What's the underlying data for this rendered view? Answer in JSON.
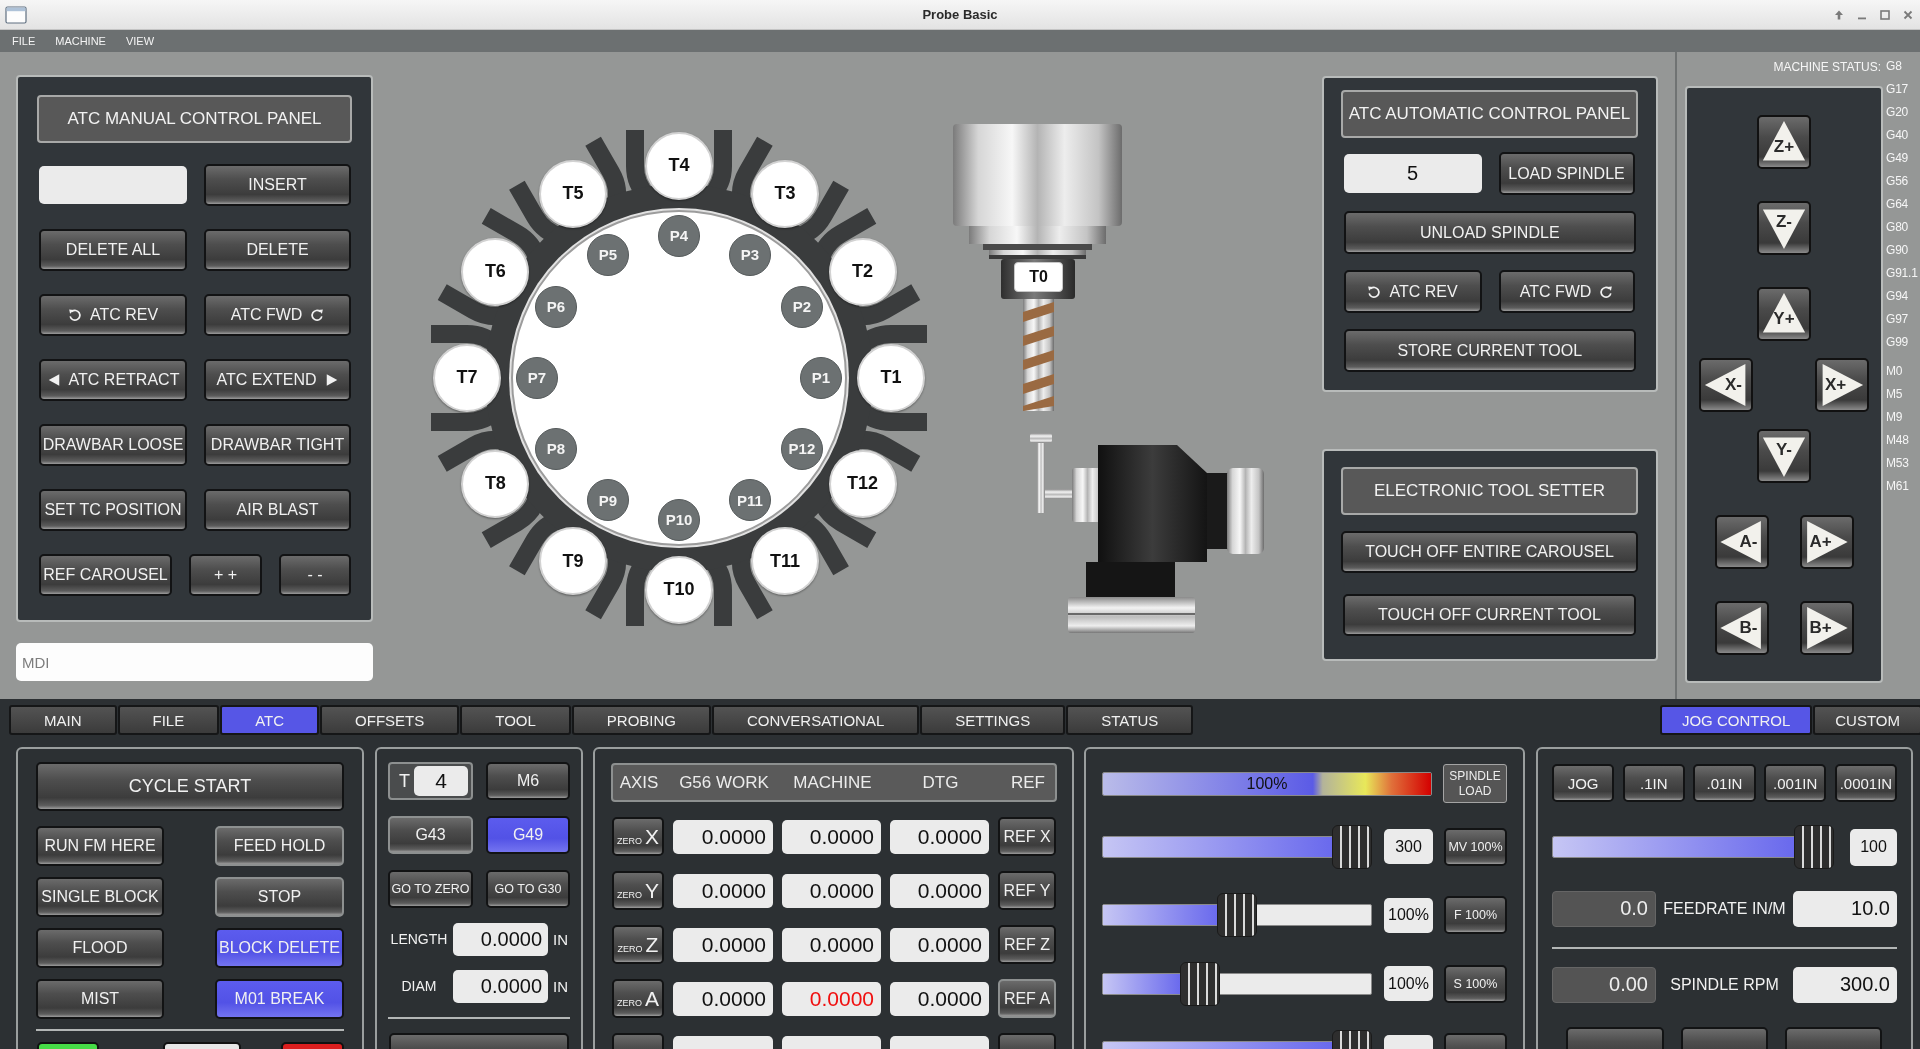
{
  "window": {
    "title": "Probe Basic"
  },
  "menu": [
    {
      "label": "FILE"
    },
    {
      "label": "MACHINE"
    },
    {
      "label": "VIEW"
    }
  ],
  "atc_manual": {
    "title": "ATC MANUAL CONTROL PANEL",
    "insert": "INSERT",
    "rows": [
      [
        {
          "label": "DELETE ALL",
          "kind": "push"
        },
        {
          "label": "DELETE",
          "kind": "push"
        }
      ],
      [
        {
          "label": "ATC REV",
          "kind": "rev"
        },
        {
          "label": "ATC FWD",
          "kind": "fwd"
        }
      ],
      [
        {
          "label": "ATC RETRACT",
          "kind": "retract"
        },
        {
          "label": "ATC EXTEND",
          "kind": "extend"
        }
      ],
      [
        {
          "label": "DRAWBAR LOOSE",
          "kind": "push"
        },
        {
          "label": "DRAWBAR TIGHT",
          "kind": "push"
        }
      ],
      [
        {
          "label": "SET TC POSITION",
          "kind": "push"
        },
        {
          "label": "AIR BLAST",
          "kind": "push"
        }
      ]
    ],
    "bottom_row": [
      {
        "label": "REF CAROUSEL"
      },
      {
        "label": "+ +"
      },
      {
        "label": "- -"
      }
    ]
  },
  "mdi": {
    "placeholder": "MDI"
  },
  "carousel": {
    "tools": [
      "T1",
      "T2",
      "T3",
      "T4",
      "T5",
      "T6",
      "T7",
      "T8",
      "T9",
      "T10",
      "T11",
      "T12"
    ],
    "positions": [
      "P1",
      "P2",
      "P3",
      "P4",
      "P5",
      "P6",
      "P7",
      "P8",
      "P9",
      "P10",
      "P11",
      "P12"
    ]
  },
  "spindle": {
    "tool_label": "T0"
  },
  "atc_auto": {
    "title": "ATC AUTOMATIC CONTROL PANEL",
    "tool_value": "5",
    "load": "LOAD SPINDLE",
    "unload": "UNLOAD SPINDLE",
    "rotate": [
      {
        "label": "ATC REV",
        "kind": "rev"
      },
      {
        "label": "ATC FWD",
        "kind": "fwd"
      }
    ],
    "store": "STORE CURRENT TOOL"
  },
  "tool_setter": {
    "title": "ELECTRONIC TOOL SETTER",
    "buttons": [
      "TOUCH OFF ENTIRE CAROUSEL",
      "TOUCH OFF CURRENT TOOL"
    ]
  },
  "machine_status": {
    "label": "MACHINE STATUS:",
    "g_codes": [
      "G8",
      "G17",
      "G20",
      "G40",
      "G49",
      "G56",
      "G64",
      "G80",
      "G90",
      "G91.1",
      "G94",
      "G97",
      "G99"
    ],
    "m_codes": [
      "M0",
      "M5",
      "M9",
      "M48",
      "M53",
      "M61"
    ]
  },
  "jog": [
    [
      {
        "label": "Z+",
        "kind": "up"
      }
    ],
    [
      {
        "label": "Z-",
        "kind": "down"
      }
    ],
    [
      {
        "label": "Y+",
        "kind": "up"
      }
    ],
    [
      {
        "label": "X-",
        "kind": "left"
      },
      {
        "label": "X+",
        "kind": "right"
      }
    ],
    [
      {
        "label": "Y-",
        "kind": "down"
      }
    ],
    [
      {
        "label": "A-",
        "kind": "left"
      },
      {
        "label": "A+",
        "kind": "right"
      }
    ],
    [
      {
        "label": "B-",
        "kind": "left"
      },
      {
        "label": "B+",
        "kind": "right"
      }
    ]
  ],
  "tabs": [
    {
      "label": "MAIN",
      "selected": false
    },
    {
      "label": "FILE",
      "selected": false
    },
    {
      "label": "ATC",
      "selected": true
    },
    {
      "label": "OFFSETS",
      "selected": false
    },
    {
      "label": "TOOL",
      "selected": false
    },
    {
      "label": "PROBING",
      "selected": false
    },
    {
      "label": "CONVERSATIONAL",
      "selected": false
    },
    {
      "label": "SETTINGS",
      "selected": false
    },
    {
      "label": "STATUS",
      "selected": false
    }
  ],
  "side_tabs": [
    {
      "label": "JOG CONTROL",
      "selected": true
    },
    {
      "label": "CUSTOM",
      "selected": false
    }
  ],
  "program": {
    "cycle_start": "CYCLE START",
    "buttons": [
      {
        "label": "RUN FM HERE",
        "kind": "push",
        "checked": false
      },
      {
        "label": "FEED HOLD",
        "kind": "toggle",
        "checked": false
      },
      {
        "label": "SINGLE BLOCK",
        "kind": "push",
        "checked": false
      },
      {
        "label": "STOP",
        "kind": "toggle",
        "checked": false
      },
      {
        "label": "FLOOD",
        "kind": "push",
        "checked": false
      },
      {
        "label": "BLOCK DELETE",
        "kind": "toggle",
        "checked": true
      },
      {
        "label": "MIST",
        "kind": "push",
        "checked": false
      },
      {
        "label": "M01 BREAK",
        "kind": "toggle",
        "checked": true
      }
    ],
    "color_buttons": [
      {
        "color": "#46dc46"
      },
      {
        "color": "#e6e6e6"
      },
      {
        "color": "#dc1e1e"
      }
    ]
  },
  "tool_panel": {
    "t_label": "T",
    "t_value": "4",
    "m6": "M6",
    "offsets": [
      {
        "label": "G43",
        "kind": "toggle",
        "checked": false
      },
      {
        "label": "G49",
        "kind": "toggle",
        "checked": true
      }
    ],
    "moves": [
      "GO TO ZERO",
      "GO TO G30"
    ],
    "fields": [
      {
        "label": "LENGTH",
        "value": "0.0000",
        "unit": "IN"
      },
      {
        "label": "DIAM",
        "value": "0.0000",
        "unit": "IN"
      }
    ]
  },
  "dro": {
    "columns": [
      "AXIS",
      "G56 WORK",
      "MACHINE",
      "DTG",
      "REF"
    ],
    "rows": [
      {
        "zero": "ZERO",
        "axis": "X",
        "work": "0.0000",
        "machine": "0.0000",
        "machine_alert": false,
        "dtg": "0.0000",
        "ref": {
          "label": "REF X",
          "kind": "push",
          "checked": false
        }
      },
      {
        "zero": "ZERO",
        "axis": "Y",
        "work": "0.0000",
        "machine": "0.0000",
        "machine_alert": false,
        "dtg": "0.0000",
        "ref": {
          "label": "REF Y",
          "kind": "push",
          "checked": false
        }
      },
      {
        "zero": "ZERO",
        "axis": "Z",
        "work": "0.0000",
        "machine": "0.0000",
        "machine_alert": false,
        "dtg": "0.0000",
        "ref": {
          "label": "REF Z",
          "kind": "push",
          "checked": false
        }
      },
      {
        "zero": "ZERO",
        "axis": "A",
        "work": "0.0000",
        "machine": "0.0000",
        "machine_alert": true,
        "dtg": "0.0000",
        "ref": {
          "label": "REF A",
          "kind": "toggle",
          "checked": false
        }
      }
    ]
  },
  "overrides": {
    "load": {
      "level": 1,
      "reading": "100%",
      "label": "SPINDLE LOAD"
    },
    "sliders": [
      {
        "level": 1,
        "value": "300",
        "button": "MV 100%"
      },
      {
        "level": 0.5,
        "value": "100%",
        "button": "F 100%"
      },
      {
        "level": 0.34,
        "value": "100%",
        "button": "S 100%"
      },
      {
        "level": 1
      }
    ]
  },
  "jog_panel": {
    "increments": [
      {
        "label": "JOG",
        "selected": false
      },
      {
        "label": ".1IN",
        "selected": false
      },
      {
        "label": ".01IN",
        "selected": false
      },
      {
        "label": ".001IN",
        "selected": false
      },
      {
        "label": ".0001IN",
        "selected": false
      }
    ],
    "speed": {
      "level": 1,
      "value": "100"
    },
    "rows": [
      {
        "current": "0.0",
        "label": "FEEDRATE IN/M",
        "value": "10.0"
      },
      {
        "current": "0.00",
        "label": "SPINDLE RPM",
        "value": "300.0"
      }
    ]
  }
}
